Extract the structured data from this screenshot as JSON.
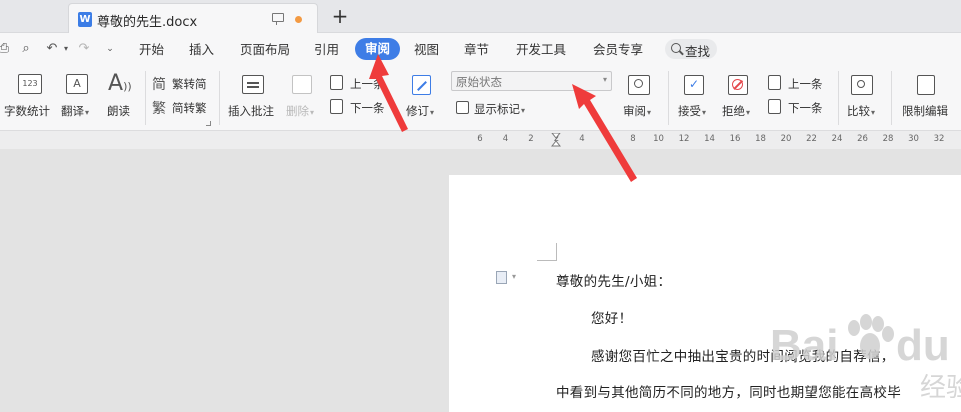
{
  "tab": {
    "title": "尊敬的先生.docx",
    "icon_letter": "W"
  },
  "menu": [
    "开始",
    "插入",
    "页面布局",
    "引用",
    "审阅",
    "视图",
    "章节",
    "开发工具",
    "会员专享"
  ],
  "search_label": "查找",
  "ribbon": {
    "word_count": "字数统计",
    "translate": "翻译",
    "read_aloud": "朗读",
    "to_traditional": "繁转简",
    "to_simplified": "简转繁",
    "insert_comment": "插入批注",
    "delete": "删除",
    "prev": "上一条",
    "next": "下一条",
    "track_changes": "修订",
    "state_value": "原始状态",
    "show_markup": "显示标记",
    "review": "审阅",
    "accept": "接受",
    "reject": "拒绝",
    "prev2": "上一条",
    "next2": "下一条",
    "compare": "比较",
    "restrict_editing": "限制编辑"
  },
  "ruler_ticks": [
    "6",
    "4",
    "2",
    "2",
    "4",
    "6",
    "8",
    "10",
    "12",
    "14",
    "16",
    "18",
    "20",
    "22",
    "24",
    "26",
    "28",
    "30",
    "32"
  ],
  "document": {
    "salutation": "尊敬的先生/小姐：",
    "greeting": "您好！",
    "line1": "感谢您百忙之中抽出宝贵的时间阅览我的自荐信，",
    "line2": "中看到与其他简历不同的地方，同时也期望您能在高校毕"
  },
  "watermark_text": "Bai du 经验",
  "colors": {
    "accent": "#3e7de6",
    "arrow": "#ef3b3b",
    "tab_dot": "#f39a43"
  }
}
